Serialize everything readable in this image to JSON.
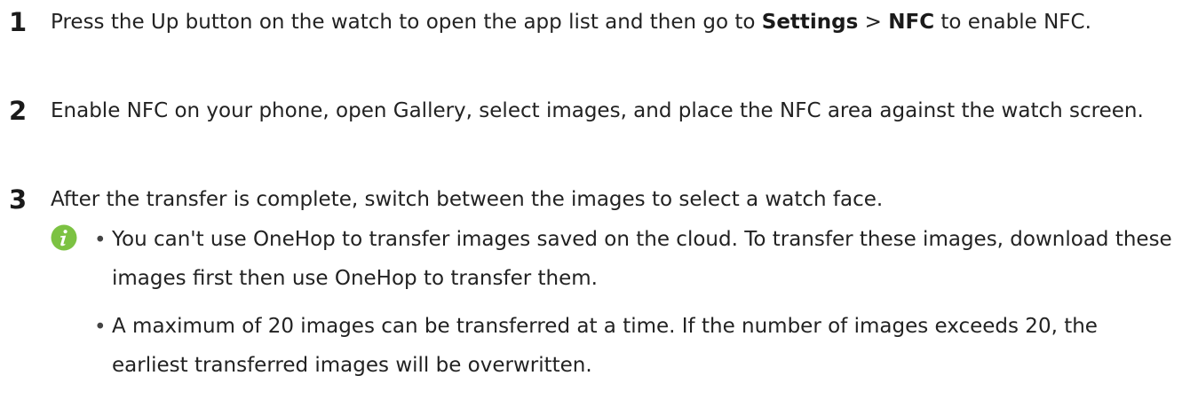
{
  "steps": [
    {
      "number": "1",
      "text_before": "Press the Up button on the watch to open the app list and then go to ",
      "bold_1": "Settings",
      "separator": " > ",
      "bold_2": "NFC",
      "text_after": " to enable NFC."
    },
    {
      "number": "2",
      "text": "Enable NFC on your phone, open Gallery, select images, and place the NFC area against the watch screen."
    },
    {
      "number": "3",
      "text": "After the transfer is complete, switch between the images to select a watch face."
    }
  ],
  "note": {
    "icon": "info-icon",
    "icon_color": "#7cc242",
    "bullet": "•",
    "items": [
      "You can't use OneHop to transfer images saved on the cloud. To transfer these images, download these images first then use OneHop to transfer them.",
      "A maximum of 20 images can be transferred at a time. If the number of images exceeds 20, the earliest transferred images will be overwritten."
    ]
  }
}
